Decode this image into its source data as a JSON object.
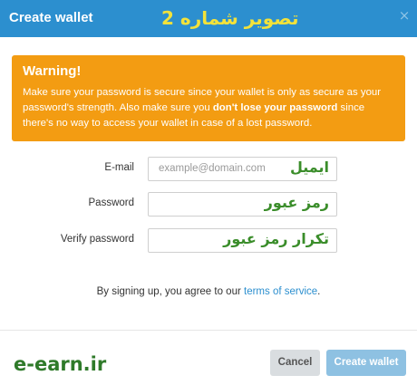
{
  "dialog": {
    "title": "Create wallet",
    "caption_fa": "تصویر شماره 2",
    "close_glyph": "×"
  },
  "warning": {
    "title": "Warning!",
    "text_1": "Make sure your password is secure since your wallet is only as secure as your password's strength. Also make sure you ",
    "text_bold": "don't lose your password",
    "text_2": " since there's no way to access your wallet in case of a lost password."
  },
  "form": {
    "email_label": "E-mail",
    "email_placeholder": "example@domain.com",
    "email_fa": "ایمیل",
    "password_label": "Password",
    "password_fa": "رمز عبور",
    "verify_label": "Verify password",
    "verify_fa": "تکرار رمز عبور"
  },
  "terms": {
    "prefix": "By signing up, you agree to our ",
    "link": "terms of service",
    "suffix": "."
  },
  "footer": {
    "brand": "e-earn.ir",
    "cancel_label": "Cancel",
    "create_label": "Create wallet"
  },
  "colors": {
    "header": "#2c8fcf",
    "warning": "#f39c12",
    "create_button": "#8ec1e2",
    "cancel_button": "#d9dde0",
    "annotation_green": "#3a8d2a",
    "caption_yellow": "#f3e23a"
  }
}
